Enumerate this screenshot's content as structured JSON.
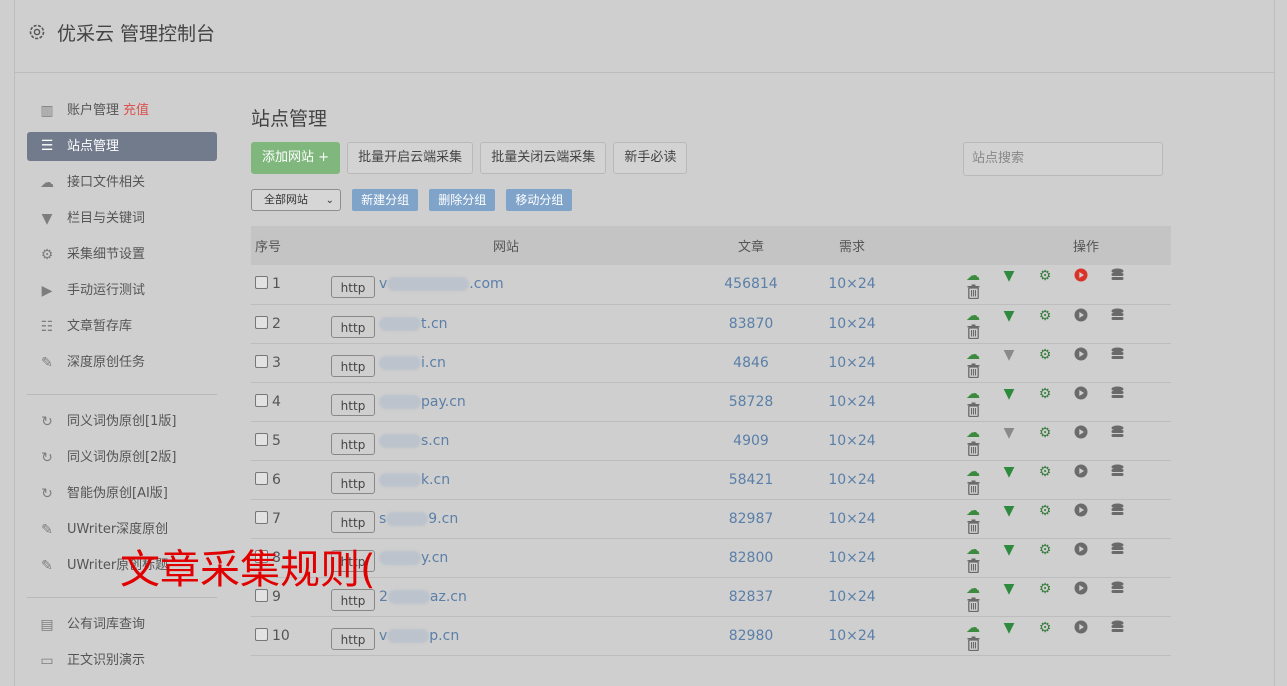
{
  "app": {
    "title": "优采云 管理控制台",
    "icon": "gear-icon"
  },
  "sidebar": {
    "group1": [
      {
        "label": "账户管理",
        "extra": "充值",
        "icon": "bar-chart-icon"
      },
      {
        "label": "站点管理",
        "icon": "server-icon",
        "active": true
      },
      {
        "label": "接口文件相关",
        "icon": "cloud-upload-icon"
      },
      {
        "label": "栏目与关键词",
        "icon": "filter-icon"
      },
      {
        "label": "采集细节设置",
        "icon": "gears-icon"
      },
      {
        "label": "手动运行测试",
        "icon": "play-circle-icon"
      },
      {
        "label": "文章暂存库",
        "icon": "database-icon"
      },
      {
        "label": "深度原创任务",
        "icon": "edit-icon"
      }
    ],
    "group2": [
      {
        "label": "同义词伪原创[1版]",
        "icon": "refresh-icon"
      },
      {
        "label": "同义词伪原创[2版]",
        "icon": "refresh-icon"
      },
      {
        "label": "智能伪原创[AI版]",
        "icon": "refresh-icon"
      },
      {
        "label": "UWriter深度原创",
        "icon": "edit-icon"
      },
      {
        "label": "UWriter原创标题",
        "icon": "edit-icon"
      }
    ],
    "group3": [
      {
        "label": "公有词库查询",
        "icon": "book-icon"
      },
      {
        "label": "正文识别演示",
        "icon": "monitor-icon"
      }
    ]
  },
  "main": {
    "title": "站点管理",
    "toolbar": {
      "add_site": "添加网站 +",
      "batch_open": "批量开启云端采集",
      "batch_close": "批量关闭云端采集",
      "newbie": "新手必读"
    },
    "search": {
      "placeholder": "站点搜索"
    },
    "group_select": "全部网站",
    "group_buttons": {
      "new": "新建分组",
      "delete": "删除分组",
      "move": "移动分组"
    },
    "table": {
      "headers": {
        "num": "序号",
        "site": "网站",
        "articles": "文章",
        "demand": "需求",
        "ops": "操作"
      },
      "rows": [
        {
          "num": "1",
          "protocol": "http",
          "prefix": "v",
          "suffix": ".com",
          "articles": "456814",
          "demand": "10×24",
          "filter_on": true,
          "play_red": true
        },
        {
          "num": "2",
          "protocol": "http",
          "prefix": "",
          "suffix": "t.cn",
          "articles": "83870",
          "demand": "10×24",
          "filter_on": true,
          "play_red": false
        },
        {
          "num": "3",
          "protocol": "http",
          "prefix": "",
          "suffix": "i.cn",
          "articles": "4846",
          "demand": "10×24",
          "filter_on": false,
          "play_red": false
        },
        {
          "num": "4",
          "protocol": "http",
          "prefix": "",
          "suffix": "pay.cn",
          "articles": "58728",
          "demand": "10×24",
          "filter_on": true,
          "play_red": false
        },
        {
          "num": "5",
          "protocol": "http",
          "prefix": "",
          "suffix": "s.cn",
          "articles": "4909",
          "demand": "10×24",
          "filter_on": false,
          "play_red": false
        },
        {
          "num": "6",
          "protocol": "http",
          "prefix": "",
          "suffix": "k.cn",
          "articles": "58421",
          "demand": "10×24",
          "filter_on": true,
          "play_red": false
        },
        {
          "num": "7",
          "protocol": "http",
          "prefix": "s",
          "suffix": "9.cn",
          "articles": "82987",
          "demand": "10×24",
          "filter_on": true,
          "play_red": false
        },
        {
          "num": "8",
          "protocol": "http",
          "prefix": "",
          "suffix": "y.cn",
          "articles": "82800",
          "demand": "10×24",
          "filter_on": true,
          "play_red": false
        },
        {
          "num": "9",
          "protocol": "http",
          "prefix": "2",
          "suffix": "az.cn",
          "articles": "82837",
          "demand": "10×24",
          "filter_on": true,
          "play_red": false
        },
        {
          "num": "10",
          "protocol": "http",
          "prefix": "v",
          "suffix": "p.cn",
          "articles": "82980",
          "demand": "10×24",
          "filter_on": true,
          "play_red": false
        }
      ]
    }
  },
  "overlay": {
    "text": "文章采集规则("
  },
  "colors": {
    "active_nav": "#727b8c",
    "green": "#7fb77d",
    "blue_btn": "#7fa3c9",
    "link": "#5a7fa8",
    "red": "#e10000"
  }
}
